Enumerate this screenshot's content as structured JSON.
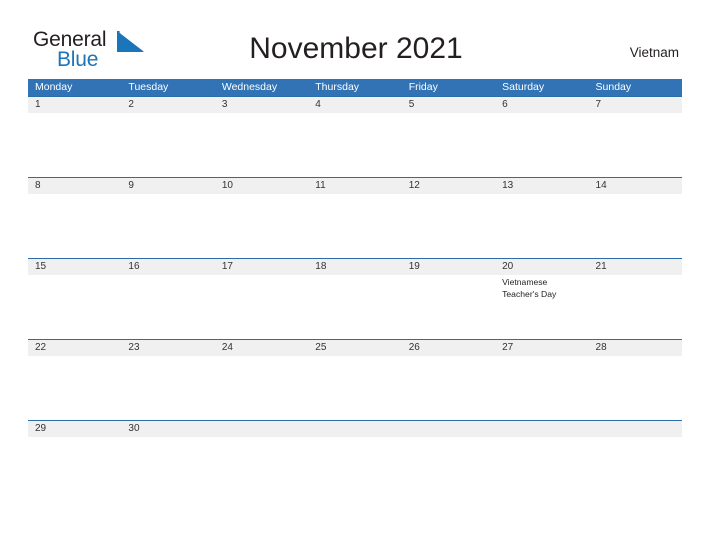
{
  "brand": {
    "name_part1": "General",
    "name_part2": "Blue",
    "triangle_icon": "blue-triangle-logo-mark",
    "color_dark": "#231f20",
    "color_blue": "#1b75bb"
  },
  "header": {
    "title": "November 2021",
    "month": "November",
    "year": "2021",
    "country": "Vietnam"
  },
  "theme": {
    "header_band": "#3173b5",
    "row_separator": "#2a6da8",
    "date_band": "#f0f0f0",
    "text": "#231f20",
    "page_background": "#ffffff"
  },
  "weekdays": [
    {
      "label": "Monday"
    },
    {
      "label": "Tuesday"
    },
    {
      "label": "Wednesday"
    },
    {
      "label": "Thursday"
    },
    {
      "label": "Friday"
    },
    {
      "label": "Saturday"
    },
    {
      "label": "Sunday"
    }
  ],
  "weeks": [
    {
      "days": [
        {
          "num": "1",
          "event": ""
        },
        {
          "num": "2",
          "event": ""
        },
        {
          "num": "3",
          "event": ""
        },
        {
          "num": "4",
          "event": ""
        },
        {
          "num": "5",
          "event": ""
        },
        {
          "num": "6",
          "event": ""
        },
        {
          "num": "7",
          "event": ""
        }
      ]
    },
    {
      "days": [
        {
          "num": "8",
          "event": ""
        },
        {
          "num": "9",
          "event": ""
        },
        {
          "num": "10",
          "event": ""
        },
        {
          "num": "11",
          "event": ""
        },
        {
          "num": "12",
          "event": ""
        },
        {
          "num": "13",
          "event": ""
        },
        {
          "num": "14",
          "event": ""
        }
      ]
    },
    {
      "days": [
        {
          "num": "15",
          "event": ""
        },
        {
          "num": "16",
          "event": ""
        },
        {
          "num": "17",
          "event": ""
        },
        {
          "num": "18",
          "event": ""
        },
        {
          "num": "19",
          "event": ""
        },
        {
          "num": "20",
          "event": "Vietnamese Teacher's Day"
        },
        {
          "num": "21",
          "event": ""
        }
      ]
    },
    {
      "days": [
        {
          "num": "22",
          "event": ""
        },
        {
          "num": "23",
          "event": ""
        },
        {
          "num": "24",
          "event": ""
        },
        {
          "num": "25",
          "event": ""
        },
        {
          "num": "26",
          "event": ""
        },
        {
          "num": "27",
          "event": ""
        },
        {
          "num": "28",
          "event": ""
        }
      ]
    },
    {
      "days": [
        {
          "num": "29",
          "event": ""
        },
        {
          "num": "30",
          "event": ""
        },
        {
          "num": "",
          "event": ""
        },
        {
          "num": "",
          "event": ""
        },
        {
          "num": "",
          "event": ""
        },
        {
          "num": "",
          "event": ""
        },
        {
          "num": "",
          "event": ""
        }
      ]
    }
  ]
}
